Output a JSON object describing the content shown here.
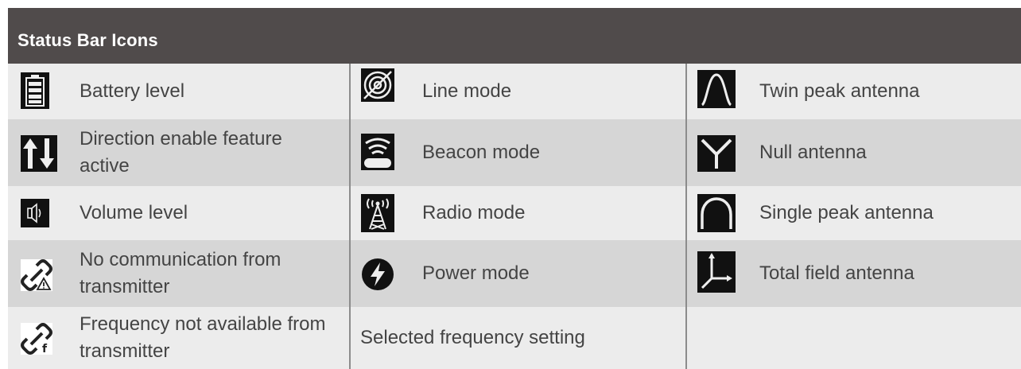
{
  "header": {
    "title": "Status Bar Icons"
  },
  "rows": [
    {
      "col1": {
        "icon": "battery-icon",
        "label": "Battery level"
      },
      "col2": {
        "icon": "line-mode-icon",
        "label": "Line  mode"
      },
      "col3": {
        "icon": "twin-peak-antenna-icon",
        "label": "Twin peak antenna"
      }
    },
    {
      "col1": {
        "icon": "direction-arrows-icon",
        "label": "Direction enable feature active"
      },
      "col2": {
        "icon": "beacon-mode-icon",
        "label": "Beacon mode"
      },
      "col3": {
        "icon": "null-antenna-icon",
        "label": "Null antenna"
      }
    },
    {
      "col1": {
        "icon": "speaker-icon",
        "label": "Volume level"
      },
      "col2": {
        "icon": "radio-tower-icon",
        "label": "Radio mode"
      },
      "col3": {
        "icon": "single-peak-antenna-icon",
        "label": "Single peak antenna"
      }
    },
    {
      "col1": {
        "icon": "broken-link-warning-icon",
        "label": "No communication from transmitter"
      },
      "col2": {
        "icon": "lightning-bolt-icon",
        "label": "Power mode"
      },
      "col3": {
        "icon": "total-field-axes-icon",
        "label": "Total field antenna"
      }
    },
    {
      "col1": {
        "icon": "broken-link-f-icon",
        "label": "Frequency not available from transmitter"
      },
      "col2": {
        "label": "Selected frequency setting"
      },
      "col3": {
        "label": ""
      }
    }
  ]
}
